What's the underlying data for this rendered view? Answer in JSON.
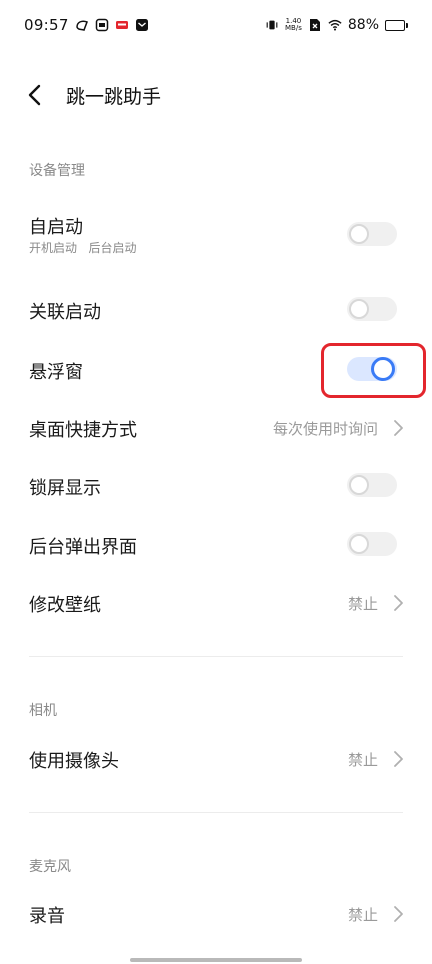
{
  "status_bar": {
    "time": "09:57",
    "net_speed_value": "1.40",
    "net_speed_unit": "MB/s",
    "battery_text": "88%",
    "battery_level": 0.88
  },
  "header": {
    "title": "跳一跳助手"
  },
  "sections": {
    "device": {
      "title": "设备管理"
    },
    "camera": {
      "title": "相机"
    },
    "mic": {
      "title": "麦克风"
    }
  },
  "rows": {
    "auto_start": {
      "label": "自启动",
      "sub": "开机启动   后台启动",
      "enabled": false
    },
    "linked_start": {
      "label": "关联启动",
      "enabled": false
    },
    "floating_window": {
      "label": "悬浮窗",
      "enabled": true
    },
    "desktop_shortcut": {
      "label": "桌面快捷方式",
      "value": "每次使用时询问"
    },
    "lock_screen": {
      "label": "锁屏显示",
      "enabled": false
    },
    "bg_popup": {
      "label": "后台弹出界面",
      "enabled": false
    },
    "wallpaper": {
      "label": "修改壁纸",
      "value": "禁止"
    },
    "use_camera": {
      "label": "使用摄像头",
      "value": "禁止"
    },
    "record_audio": {
      "label": "录音",
      "value": "禁止"
    }
  },
  "colors": {
    "accent": "#3a7bf6",
    "highlight": "#e3262d"
  }
}
